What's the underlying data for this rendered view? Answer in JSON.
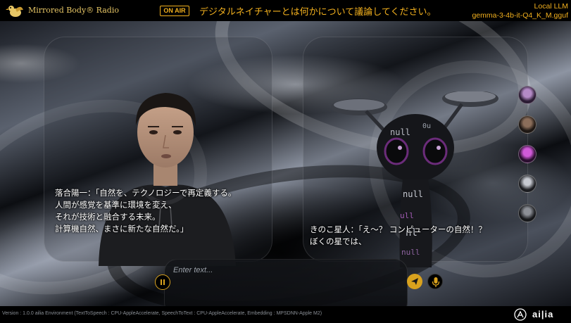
{
  "header": {
    "brand": "Mirrored Body® Radio",
    "on_air_label": "ON AIR",
    "topic": "デジタルネイチャーとは何かについて議論してください。",
    "llm_title": "Local LLM",
    "llm_model": "gemma-3-4b-it-Q4_K_M.gguf"
  },
  "speakers": {
    "left": {
      "text": "落合陽一：「自然を、テクノロジーで再定義する。\n人間が感覚を基準に環境を変え、\nそれが技術と融合する未来。\n計算機自然、まさに新たな自然だ。」"
    },
    "right": {
      "text": "きのこ星人：「え〜？ コンピューターの自然！？\nぼくの星では、"
    }
  },
  "avatars": [
    "avatar-1",
    "avatar-2",
    "avatar-3",
    "avatar-4",
    "avatar-5"
  ],
  "input": {
    "placeholder": "Enter text..."
  },
  "icons": {
    "pause": "pause-icon",
    "send": "send-icon",
    "mic": "microphone-icon"
  },
  "footer": {
    "version": "Version : 1.0.0 ailia Environment (TextToSpeech : CPU-AppleAccelerate, SpeechToText : CPU-AppleAccelerate, Embedding : MPSDNN-Apple M2)",
    "logo_text": "ai|ia"
  },
  "colors": {
    "accent": "#f2b01e",
    "brand_gold": "#e8c766"
  }
}
